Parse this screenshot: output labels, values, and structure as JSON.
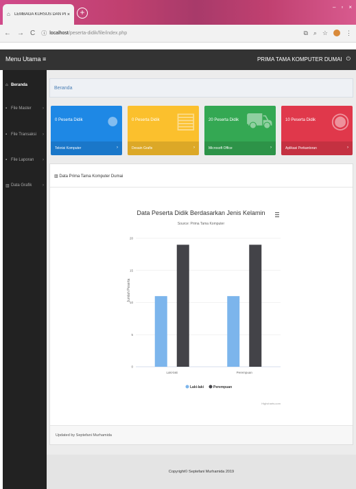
{
  "browser": {
    "tab_title": "LEMBAGA KURSUS DAN PELATI",
    "url_host": "localhost",
    "url_path": "/peserta-didik/file/index.php"
  },
  "header": {
    "menu_title": "Menu Utama ≡",
    "brand": "PRIMA TAMA KOMPUTER DUMAI"
  },
  "sidebar": {
    "items": [
      {
        "label": "Beranda"
      },
      {
        "label": "File Master"
      },
      {
        "label": "File Transaksi"
      },
      {
        "label": "File Laporan"
      },
      {
        "label": "Data Grafik"
      }
    ]
  },
  "breadcrumb": "Beranda",
  "cards": [
    {
      "count": "0 Peserta Didik",
      "label": "Teknisi Komputer",
      "color": "#1e88e5"
    },
    {
      "count": "0 Peserta Didik",
      "label": "Desain Grafis",
      "color": "#fbc02d"
    },
    {
      "count": "20 Peserta Didik",
      "label": "Microsoft Office",
      "color": "#34a853"
    },
    {
      "count": "10 Peserta Didik",
      "label": "Aplikasi Perkantoran",
      "color": "#e0384b"
    }
  ],
  "panel": {
    "heading": "Data Prima Tama Komputer Dumai",
    "footer": "Updated by Septefani Murhamida"
  },
  "footer": "Copyright© Septefani Murhamida 2019",
  "chart_data": {
    "type": "bar",
    "title": "Data Peserta Didik Berdasarkan Jenis Kelamin",
    "subtitle": "Source: Prima Tama Komputer",
    "ylabel": "Jumlah Peserta",
    "categories": [
      "Laki-laki",
      "Perempuan"
    ],
    "ylim": [
      0,
      20
    ],
    "yticks": [
      0,
      5,
      10,
      15,
      20
    ],
    "series": [
      {
        "name": "Laki-laki",
        "values": [
          11,
          11
        ],
        "color": "#7cb5ec"
      },
      {
        "name": "Perempuan",
        "values": [
          19,
          19
        ],
        "color": "#434348"
      }
    ],
    "credits": "Highcharts.com",
    "legend_position": "bottom"
  }
}
